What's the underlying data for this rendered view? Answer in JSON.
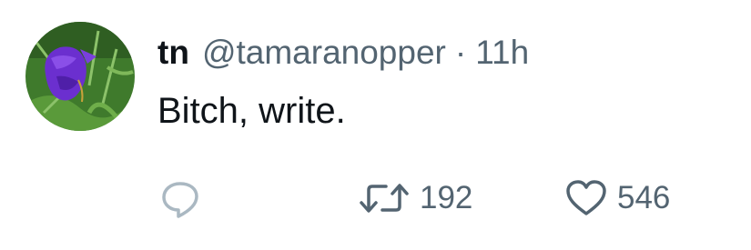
{
  "tweet": {
    "display_name": "tn",
    "handle": "@tamaranopper",
    "separator": "·",
    "time": "11h",
    "text": "Bitch, write.",
    "avatar_icon": "purple-flower-photo"
  },
  "actions": {
    "reply": {
      "icon": "reply-icon"
    },
    "retweet": {
      "icon": "retweet-icon",
      "count": "192"
    },
    "like": {
      "icon": "heart-icon",
      "count": "546"
    }
  },
  "colors": {
    "text_primary": "#0f1419",
    "text_secondary": "#536471",
    "reply_icon": "#aab8c2",
    "background": "#ffffff"
  }
}
